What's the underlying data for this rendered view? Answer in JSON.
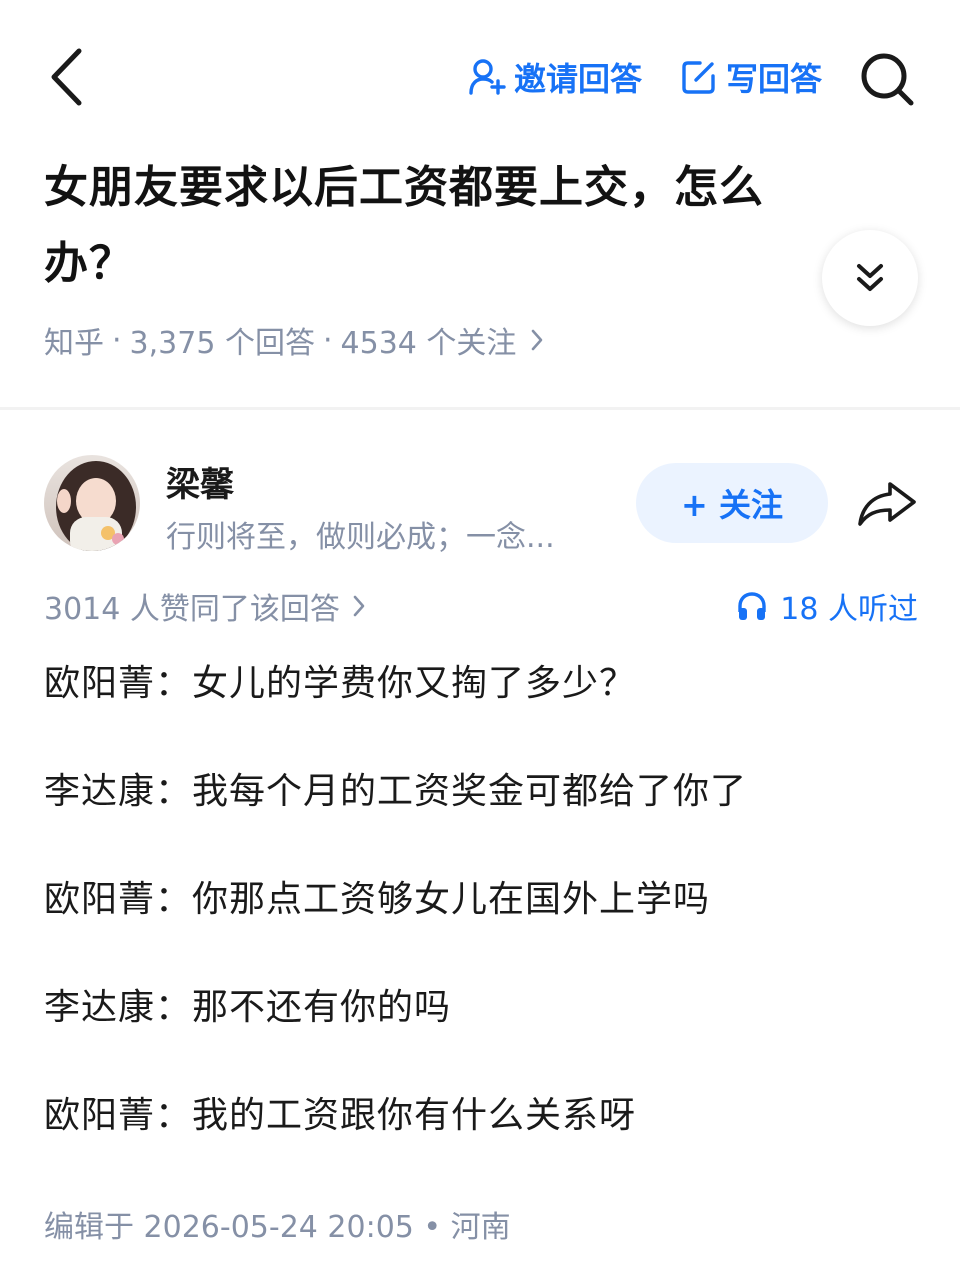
{
  "topbar": {
    "invite_label": "邀请回答",
    "write_label": "写回答",
    "accent": "#1772f6"
  },
  "question": {
    "title": "女朋友要求以后工资都要上交，怎么办？",
    "source": "知乎",
    "answer_count": "3,375 个回答",
    "follower_count": "4534 个关注",
    "separator": "·"
  },
  "author": {
    "name": "梁馨",
    "bio": "行则将至，做则必成；一念...",
    "follow_label": "+ 关注"
  },
  "stats": {
    "votes": "3014 人赞同了该回答",
    "listeners": "18 人听过"
  },
  "content": {
    "lines": [
      "欧阳菁：女儿的学费你又掏了多少？",
      "李达康：我每个月的工资奖金可都给了你了",
      "欧阳菁：你那点工资够女儿在国外上学吗",
      "李达康：那不还有你的吗",
      "欧阳菁：我的工资跟你有什么关系呀"
    ]
  },
  "edit_info": "编辑于 2026-05-24 20:05 • 河南",
  "icons": {
    "back": "chevron-left-icon",
    "invite": "person-add-icon",
    "write": "edit-icon",
    "search": "search-icon",
    "expand": "double-chevron-down-icon",
    "share": "share-arrow-icon",
    "listen": "headphones-icon"
  }
}
